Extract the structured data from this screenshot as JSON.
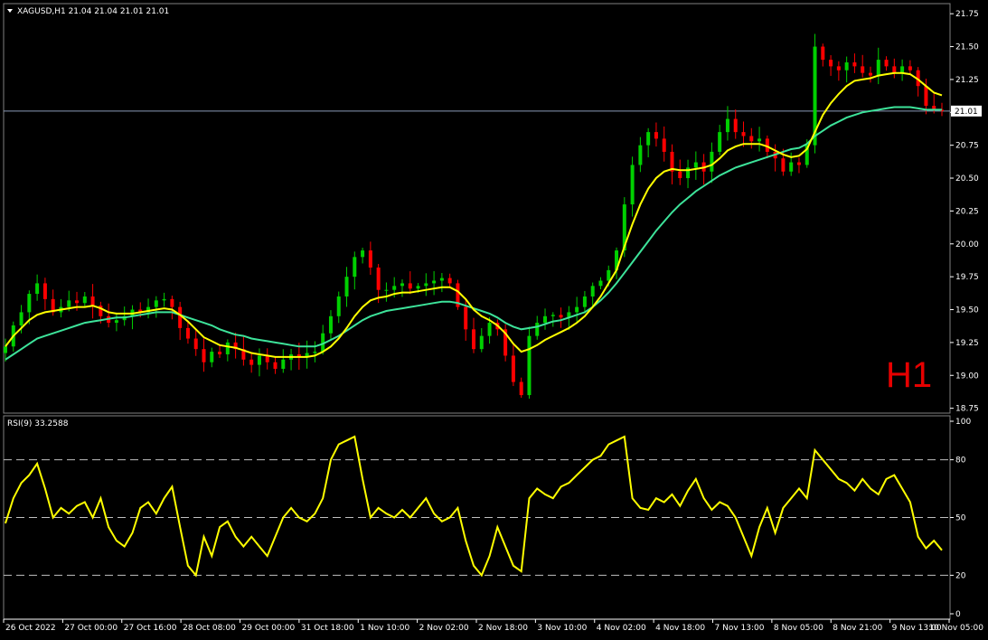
{
  "chart_data": [
    {
      "type": "candlestick",
      "symbol_header": "XAGUSD,H1  21.04 21.04 21.01 21.01",
      "corner_label": "H1",
      "ylim": [
        18.72,
        21.82
      ],
      "y_ticks": [
        "21.75",
        "21.50",
        "21.25",
        "21.00",
        "20.75",
        "20.50",
        "20.25",
        "20.00",
        "19.75",
        "19.50",
        "19.25",
        "19.00",
        "18.75"
      ],
      "current_price": "21.01",
      "colors": {
        "up": "#00d000",
        "down": "#ff0000",
        "ma_fast": "#ffff00",
        "ma_slow": "#3de39a",
        "background": "#000000",
        "price_line": "#8a9ab8"
      },
      "close": [
        19.22,
        19.38,
        19.48,
        19.62,
        19.7,
        19.58,
        19.48,
        19.52,
        19.57,
        19.55,
        19.6,
        19.53,
        19.45,
        19.4,
        19.42,
        19.45,
        19.5,
        19.48,
        19.52,
        19.57,
        19.58,
        19.52,
        19.36,
        19.28,
        19.2,
        19.1,
        19.18,
        19.16,
        19.25,
        19.2,
        19.12,
        19.08,
        19.15,
        19.1,
        19.05,
        19.12,
        19.16,
        19.14,
        19.17,
        19.18,
        19.32,
        19.45,
        19.6,
        19.75,
        19.9,
        19.95,
        19.82,
        19.65,
        19.65,
        19.68,
        19.7,
        19.66,
        19.68,
        19.7,
        19.72,
        19.74,
        19.7,
        19.52,
        19.35,
        19.2,
        19.3,
        19.4,
        19.35,
        19.15,
        18.95,
        18.85,
        19.3,
        19.4,
        19.45,
        19.46,
        19.44,
        19.48,
        19.52,
        19.6,
        19.68,
        19.72,
        19.8,
        19.95,
        20.3,
        20.6,
        20.75,
        20.85,
        20.8,
        20.7,
        20.55,
        20.5,
        20.58,
        20.62,
        20.55,
        20.7,
        20.85,
        20.95,
        20.85,
        20.82,
        20.78,
        20.8,
        20.7,
        20.65,
        20.55,
        20.62,
        20.6,
        20.75,
        21.5,
        21.4,
        21.35,
        21.32,
        21.38,
        21.35,
        21.3,
        21.28,
        21.4,
        21.35,
        21.3,
        21.35,
        21.32,
        21.2,
        21.05,
        21.02,
        21.01
      ],
      "ma_fast": [
        19.22,
        19.3,
        19.36,
        19.42,
        19.46,
        19.48,
        19.49,
        19.5,
        19.51,
        19.52,
        19.52,
        19.53,
        19.51,
        19.48,
        19.47,
        19.47,
        19.47,
        19.48,
        19.49,
        19.5,
        19.51,
        19.5,
        19.46,
        19.41,
        19.35,
        19.29,
        19.26,
        19.23,
        19.22,
        19.21,
        19.19,
        19.17,
        19.16,
        19.15,
        19.14,
        19.14,
        19.14,
        19.14,
        19.14,
        19.15,
        19.18,
        19.22,
        19.28,
        19.36,
        19.45,
        19.52,
        19.57,
        19.59,
        19.6,
        19.62,
        19.63,
        19.63,
        19.64,
        19.65,
        19.66,
        19.67,
        19.67,
        19.64,
        19.58,
        19.5,
        19.45,
        19.42,
        19.38,
        19.32,
        19.24,
        19.18,
        19.2,
        19.23,
        19.27,
        19.3,
        19.33,
        19.36,
        19.4,
        19.45,
        19.52,
        19.6,
        19.7,
        19.8,
        19.98,
        20.15,
        20.3,
        20.42,
        20.5,
        20.55,
        20.57,
        20.56,
        20.56,
        20.57,
        20.58,
        20.6,
        20.65,
        20.71,
        20.74,
        20.76,
        20.76,
        20.76,
        20.74,
        20.71,
        20.68,
        20.66,
        20.67,
        20.72,
        20.85,
        20.98,
        21.07,
        21.14,
        21.2,
        21.24,
        21.25,
        21.26,
        21.28,
        21.29,
        21.3,
        21.3,
        21.29,
        21.25,
        21.2,
        21.15,
        21.13
      ],
      "ma_slow": [
        19.12,
        19.16,
        19.2,
        19.24,
        19.28,
        19.3,
        19.32,
        19.34,
        19.36,
        19.38,
        19.4,
        19.41,
        19.42,
        19.43,
        19.44,
        19.44,
        19.45,
        19.46,
        19.47,
        19.48,
        19.48,
        19.48,
        19.46,
        19.44,
        19.42,
        19.4,
        19.38,
        19.35,
        19.33,
        19.31,
        19.3,
        19.28,
        19.27,
        19.26,
        19.25,
        19.24,
        19.23,
        19.22,
        19.22,
        19.22,
        19.24,
        19.27,
        19.3,
        19.34,
        19.38,
        19.42,
        19.45,
        19.47,
        19.49,
        19.5,
        19.51,
        19.52,
        19.53,
        19.54,
        19.55,
        19.56,
        19.56,
        19.55,
        19.53,
        19.51,
        19.49,
        19.47,
        19.44,
        19.4,
        19.37,
        19.35,
        19.36,
        19.37,
        19.39,
        19.41,
        19.42,
        19.44,
        19.46,
        19.48,
        19.52,
        19.57,
        19.63,
        19.7,
        19.78,
        19.86,
        19.94,
        20.02,
        20.1,
        20.17,
        20.24,
        20.3,
        20.35,
        20.4,
        20.44,
        20.48,
        20.52,
        20.55,
        20.58,
        20.6,
        20.62,
        20.64,
        20.66,
        20.68,
        20.7,
        20.72,
        20.73,
        20.76,
        20.82,
        20.86,
        20.9,
        20.93,
        20.96,
        20.98,
        21.0,
        21.01,
        21.02,
        21.03,
        21.04,
        21.04,
        21.04,
        21.03,
        21.02,
        21.02,
        21.02
      ]
    },
    {
      "type": "line",
      "header": "RSI(9) 33.2588",
      "ylim": [
        0,
        100
      ],
      "y_ticks": [
        "100",
        "80",
        "50",
        "20",
        "0"
      ],
      "levels": [
        80,
        50,
        20
      ],
      "color": "#ffff00",
      "values": [
        47,
        60,
        68,
        72,
        78,
        65,
        50,
        55,
        52,
        56,
        58,
        50,
        60,
        45,
        38,
        35,
        42,
        55,
        58,
        52,
        60,
        66,
        45,
        25,
        20,
        40,
        30,
        45,
        48,
        40,
        35,
        40,
        35,
        30,
        40,
        50,
        55,
        50,
        48,
        52,
        60,
        80,
        88,
        90,
        92,
        70,
        50,
        55,
        52,
        50,
        54,
        50,
        55,
        60,
        52,
        48,
        50,
        55,
        38,
        25,
        20,
        30,
        45,
        35,
        25,
        22,
        60,
        65,
        62,
        60,
        66,
        68,
        72,
        76,
        80,
        82,
        88,
        90,
        92,
        60,
        55,
        54,
        60,
        58,
        62,
        56,
        64,
        70,
        60,
        54,
        58,
        56,
        50,
        40,
        30,
        45,
        55,
        42,
        55,
        60,
        65,
        60,
        85,
        80,
        75,
        70,
        68,
        64,
        70,
        65,
        62,
        70,
        72,
        65,
        58,
        40,
        34,
        38,
        33
      ]
    },
    {
      "type": "time-axis",
      "x_ticks": [
        "26 Oct 2022",
        "27 Oct 00:00",
        "27 Oct 16:00",
        "28 Oct 08:00",
        "29 Oct 00:00",
        "31 Oct 18:00",
        "1 Nov 10:00",
        "2 Nov 02:00",
        "2 Nov 18:00",
        "3 Nov 10:00",
        "4 Nov 02:00",
        "4 Nov 18:00",
        "7 Nov 13:00",
        "8 Nov 05:00",
        "8 Nov 21:00",
        "9 Nov 13:00",
        "10 Nov 05:00"
      ]
    }
  ]
}
